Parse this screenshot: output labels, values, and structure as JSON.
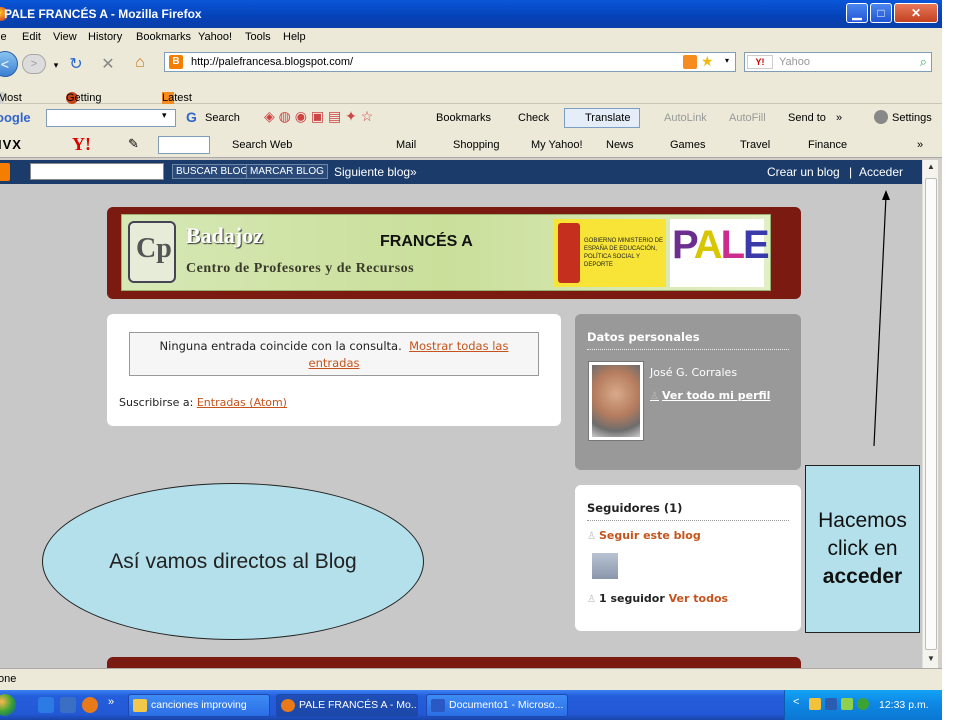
{
  "window": {
    "title": "PALE FRANCÉS A - Mozilla Firefox",
    "min_label": "▁",
    "max_label": "□",
    "close_label": "✕"
  },
  "menu": {
    "file": "le",
    "edit": "Edit",
    "view": "View",
    "history": "History",
    "bookmarks": "Bookmarks",
    "yahoo": "Yahoo!",
    "tools": "Tools",
    "help": "Help"
  },
  "nav": {
    "url": "http://palefrancesa.blogspot.com/",
    "search_placeholder": "Yahoo",
    "yahoo_logo": "Y!"
  },
  "bookmarks_bar": {
    "items": [
      "Most Visited",
      "Getting Started",
      "Latest Headlines"
    ]
  },
  "google_toolbar": {
    "logo": "oogle",
    "search": "Search",
    "bookmarks": "Bookmarks",
    "check": "Check",
    "translate": "Translate",
    "autolink": "AutoLink",
    "autofill": "AutoFill",
    "send_to": "Send to",
    "more": "»",
    "settings": "Settings"
  },
  "yahoo_toolbar": {
    "divx": "IVX",
    "yahoo": "Y!",
    "search_web": "Search Web",
    "mail": "Mail",
    "shopping": "Shopping",
    "my_yahoo": "My Yahoo!",
    "news": "News",
    "games": "Games",
    "travel": "Travel",
    "finance": "Finance",
    "more": "»"
  },
  "blogger_bar": {
    "buscar_blog": "BUSCAR BLOG",
    "marcar_blog": "MARCAR BLOG",
    "siguiente": "Siguiente blog»",
    "crear": "Crear un blog",
    "separator": "|",
    "acceder": "Acceder"
  },
  "banner": {
    "badajoz": "Badajoz",
    "centro": "Centro de Profesores y de Recursos",
    "frances": "FRANCÉS A",
    "gobierno": "GOBIERNO MINISTERIO DE ESPAÑA DE EDUCACIÓN, POLÍTICA SOCIAL Y DEPORTE",
    "pale": [
      "P",
      "A",
      "L",
      "E"
    ],
    "cp_letter": "Cp"
  },
  "main": {
    "no_match": "Ninguna entrada coincide con la consulta.",
    "show_all": "Mostrar todas las entradas",
    "subscribe_label": "Suscribirse a:",
    "subscribe_link": "Entradas (Atom)"
  },
  "datos": {
    "heading": "Datos personales",
    "name": "José G. Corrales",
    "profile_link": "Ver todo mi perfil"
  },
  "seguidores": {
    "heading": "Seguidores (1)",
    "follow": "Seguir este blog",
    "count": "1 seguidor",
    "view_all": "Ver todos"
  },
  "annotations": {
    "ellipse_text": "Así vamos directos al Blog",
    "callout_line1": "Hacemos",
    "callout_line2": "click en",
    "callout_bold": "acceder"
  },
  "status": {
    "text": "one"
  },
  "taskbar": {
    "more": "»",
    "tasks": [
      "canciones improving",
      "PALE FRANCÉS A - Mo...",
      "Documento1 - Microso..."
    ],
    "clock": "12:33 p.m.",
    "tray_arrow": "<"
  }
}
